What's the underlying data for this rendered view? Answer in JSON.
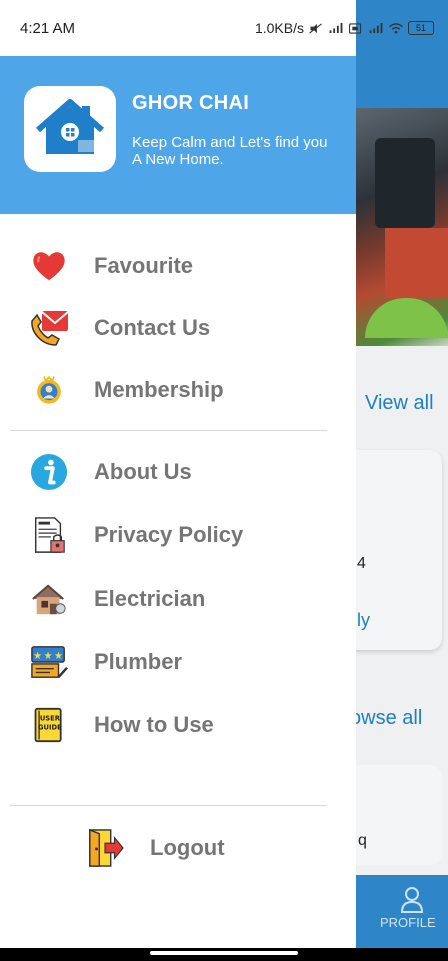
{
  "status_bar": {
    "time": "4:21 AM",
    "speed": "1.0KB/s",
    "battery": "51"
  },
  "drawer": {
    "title": "GHOR CHAI",
    "tagline": "Keep Calm and Let's find you A New Home.",
    "logo_icon": "house-icon",
    "section1": [
      {
        "label": "Favourite",
        "icon": "heart-icon"
      },
      {
        "label": "Contact Us",
        "icon": "phone-mail-icon"
      },
      {
        "label": "Membership",
        "icon": "member-badge-icon"
      }
    ],
    "section2": [
      {
        "label": "About Us",
        "icon": "info-icon"
      },
      {
        "label": "Privacy Policy",
        "icon": "policy-document-icon"
      },
      {
        "label": "Electrician",
        "icon": "electrician-house-icon"
      },
      {
        "label": "Plumber",
        "icon": "plumber-rating-icon"
      },
      {
        "label": "How to Use",
        "icon": "user-guide-icon"
      }
    ],
    "logout_label": "Logout"
  },
  "background": {
    "view_all": "View all",
    "card_number": "4",
    "card_link": "ly",
    "browse_all": "owse all",
    "card2_text": "q",
    "profile_label": "PROFILE"
  },
  "colors": {
    "drawer_header": "#4ea6e8",
    "app_bar": "#2e86c8",
    "menu_text": "#757575"
  }
}
